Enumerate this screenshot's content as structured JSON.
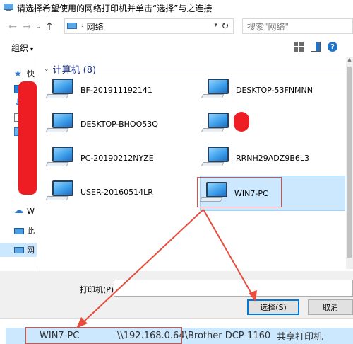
{
  "window": {
    "title": "请选择希望使用的网络打印机并单击“选择”与之连接"
  },
  "nav": {
    "back": "←",
    "forward": "→",
    "recent": "⌄",
    "up": "↑",
    "address": {
      "crumb": "网络",
      "separator": "›"
    },
    "refresh": "↻",
    "search_placeholder": "搜索\"网络\""
  },
  "toolbar": {
    "organize_label": "组织",
    "organize_arrow": "▾"
  },
  "sidebar": {
    "items": [
      {
        "label": "快",
        "icon": "quick-access-icon"
      },
      {
        "label": "桌",
        "icon": "desktop-icon"
      },
      {
        "label": "下",
        "icon": "downloads-icon"
      },
      {
        "label": "文",
        "icon": "documents-icon"
      },
      {
        "label": "图",
        "icon": "pictures-icon"
      },
      {
        "label": "W",
        "icon": "onedrive-icon"
      },
      {
        "label": "此",
        "icon": "this-pc-icon"
      },
      {
        "label": "网",
        "icon": "network-icon"
      }
    ]
  },
  "main": {
    "group_title": "计算机 (8)",
    "computers": [
      {
        "name": "BF-201911192141"
      },
      {
        "name": "DESKTOP-53FNMNN"
      },
      {
        "name": "DESKTOP-BHOO53Q"
      },
      {
        "name": ""
      },
      {
        "name": "PC-20190212NYZE"
      },
      {
        "name": "RRNH29ADZ9B6L3"
      },
      {
        "name": "USER-20160514LR"
      },
      {
        "name": "WIN7-PC",
        "selected": true
      }
    ]
  },
  "footer": {
    "printer_label": "打印机(P):",
    "printer_value": "",
    "select_button": "选择(S)",
    "cancel_button": "取消"
  },
  "results": {
    "row": {
      "name": "WIN7-PC",
      "address": "\\\\192.168.0.64\\Brother DCP-1160",
      "type": "共享打印机"
    }
  },
  "colors": {
    "annotation": "#e74c3c",
    "selection": "#cce8ff",
    "accent": "#0078d7"
  }
}
